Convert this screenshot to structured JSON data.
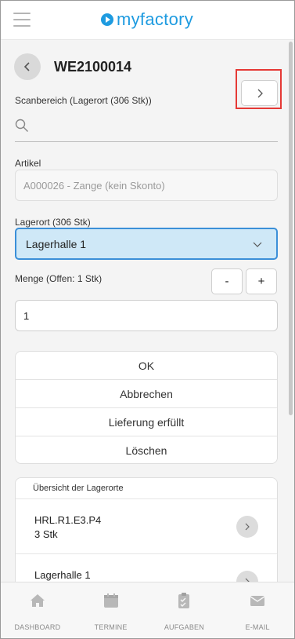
{
  "header": {
    "brand": "myfactory",
    "brand_color": "#1e9be0"
  },
  "document": {
    "title": "WE2100014"
  },
  "scan": {
    "label": "Scanbereich (Lagerort (306 Stk))",
    "placeholder": ""
  },
  "article": {
    "label": "Artikel",
    "value": "A000026 - Zange (kein Skonto)"
  },
  "location": {
    "label": "Lagerort (306 Stk)",
    "selected": "Lagerhalle 1"
  },
  "quantity": {
    "label": "Menge (Offen: 1 Stk)",
    "minus_label": "-",
    "plus_label": "+",
    "value": "1"
  },
  "actions": {
    "ok": "OK",
    "cancel": "Abbrechen",
    "delivered": "Lieferung erfüllt",
    "delete": "Löschen"
  },
  "overview": {
    "title": "Übersicht der Lagerorte",
    "items": [
      {
        "name": "HRL.R1.E3.P4",
        "qty": "3 Stk"
      },
      {
        "name": "Lagerhalle 1",
        "qty": ""
      }
    ]
  },
  "nav": [
    {
      "label": "DASHBOARD",
      "icon": "home-icon"
    },
    {
      "label": "TERMINE",
      "icon": "calendar-icon"
    },
    {
      "label": "AUFGABEN",
      "icon": "clipboard-icon"
    },
    {
      "label": "E-MAIL",
      "icon": "mail-icon"
    }
  ],
  "colors": {
    "highlight": "#e53935",
    "select_bg": "#cfe8f7",
    "select_border": "#3b8fd8"
  }
}
